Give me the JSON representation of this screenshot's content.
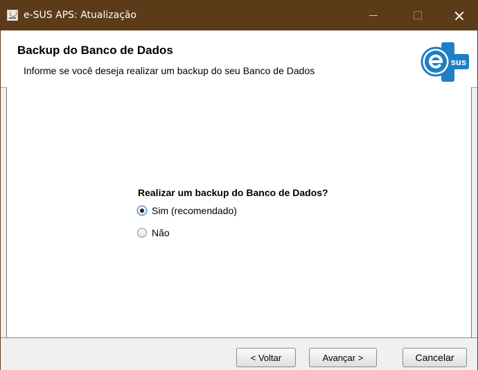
{
  "window": {
    "title": "e-SUS APS: Atualização",
    "icon": "java-cup-icon",
    "controls": [
      "minimize-icon",
      "maximize-icon",
      "close-icon"
    ]
  },
  "header": {
    "title": "Backup do Banco de Dados",
    "subtitle": "Informe se você deseja realizar um backup do seu Banco de Dados",
    "logo_text": "sus"
  },
  "body": {
    "question": "Realizar um backup do Banco de Dados?",
    "options": [
      {
        "label": "Sim (recomendado)",
        "checked": true
      },
      {
        "label": "Não",
        "checked": false
      }
    ]
  },
  "footer": {
    "back_label": "< Voltar",
    "next_label": "Avançar >",
    "cancel_label": "Cancelar"
  },
  "colors": {
    "titlebar": "#5c3b18",
    "logo_blue": "#1e7fc6"
  }
}
